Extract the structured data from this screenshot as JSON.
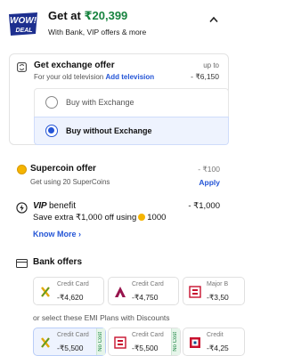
{
  "header": {
    "logo_line1": "WOW!",
    "logo_line2": "DEAL",
    "get_at_prefix": "Get at ",
    "price": "₹20,399",
    "subtitle": "With Bank, VIP offers & more"
  },
  "exchange": {
    "title": "Get exchange offer",
    "subtitle": "For your old television ",
    "add_link": "Add television",
    "upto_label": "up to",
    "amount": "- ₹6,150",
    "options": [
      {
        "label": "Buy with Exchange",
        "selected": false
      },
      {
        "label": "Buy without Exchange",
        "selected": true
      }
    ]
  },
  "supercoin": {
    "title": "Supercoin offer",
    "subtitle": "Get using 20 SuperCoins",
    "amount": "- ₹100",
    "apply": "Apply"
  },
  "vip": {
    "brand": "VIP",
    "title_suffix": " benefit",
    "save_text": "Save extra ₹1,000 off using",
    "coins": "1000",
    "amount": "- ₹1,000",
    "know_more": "Know More ›"
  },
  "bank": {
    "title": "Bank offers",
    "offers": [
      {
        "kind": "Credit Card",
        "amount": "-₹4,620"
      },
      {
        "kind": "Credit Card",
        "amount": "-₹4,750"
      },
      {
        "kind": "Major B",
        "amount": "-₹3,50"
      }
    ],
    "emi_note": "or select these EMI Plans with Discounts",
    "emi": [
      {
        "kind": "Credit Card",
        "amount": "-₹5,500",
        "tag": "No Cost"
      },
      {
        "kind": "Credit Card",
        "amount": "-₹5,500",
        "tag": "No Cost"
      },
      {
        "kind": "Credit",
        "amount": "-₹4,25"
      }
    ]
  },
  "colors": {
    "accent_blue": "#2455d6",
    "price_green": "#17833f",
    "logo_navy": "#1d2f8f",
    "coin_gold": "#f5b400"
  }
}
